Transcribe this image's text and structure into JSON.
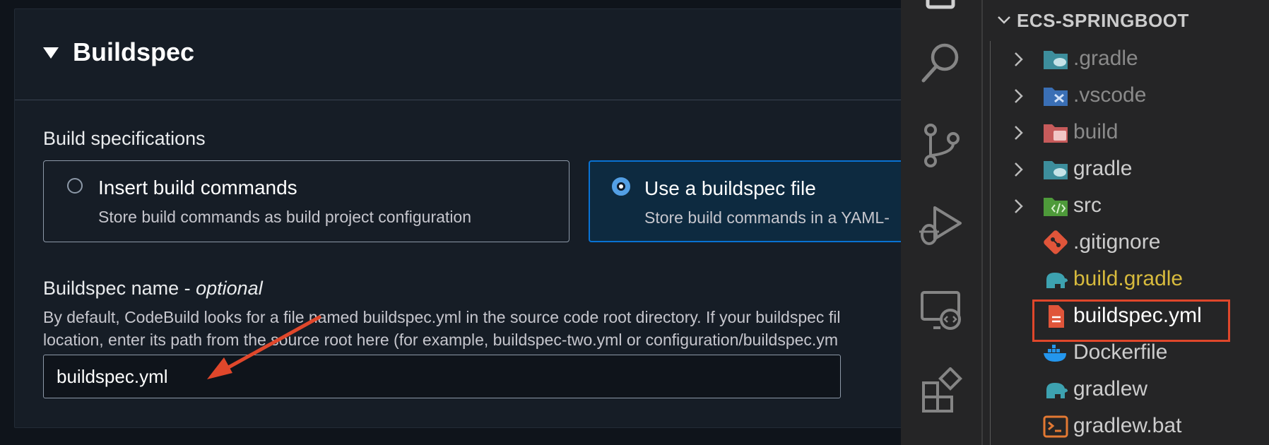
{
  "aws": {
    "section_title": "Buildspec",
    "build_spec_label": "Build specifications",
    "options": [
      {
        "title": "Insert build commands",
        "desc": "Store build commands as build project configuration",
        "selected": false
      },
      {
        "title": "Use a buildspec file",
        "desc": "Store build commands in a YAML-",
        "selected": true
      }
    ],
    "name_label": "Buildspec name - ",
    "name_label_optional": "optional",
    "help_line1": "By default, CodeBuild looks for a file named buildspec.yml in the source code root directory. If your buildspec fil",
    "help_line2": "location, enter its path from the source root here (for example, buildspec-two.yml or configuration/buildspec.ym",
    "input_value": "buildspec.yml",
    "arrow_color": "#e0472b"
  },
  "vscode": {
    "project_name": "ECS-SPRINGBOOT",
    "activity_icons": [
      "files-icon",
      "search-icon",
      "source-control-icon",
      "run-debug-icon",
      "remote-explorer-icon",
      "extensions-icon"
    ],
    "files": [
      {
        "name": ".gradle",
        "type": "folder",
        "icon": "gradle-folder-icon",
        "dim": true
      },
      {
        "name": ".vscode",
        "type": "folder",
        "icon": "vscode-folder-icon",
        "dim": true
      },
      {
        "name": "build",
        "type": "folder",
        "icon": "build-folder-icon",
        "dim": true
      },
      {
        "name": "gradle",
        "type": "folder",
        "icon": "gradle-folder-icon",
        "dim": false
      },
      {
        "name": "src",
        "type": "folder",
        "icon": "src-folder-icon",
        "dim": false
      },
      {
        "name": ".gitignore",
        "type": "file",
        "icon": "git-icon",
        "dim": false
      },
      {
        "name": "build.gradle",
        "type": "file",
        "icon": "gradle-elephant-icon",
        "dim": false,
        "modified": true
      },
      {
        "name": "buildspec.yml",
        "type": "file",
        "icon": "yaml-file-icon",
        "dim": false,
        "highlighted": true
      },
      {
        "name": "Dockerfile",
        "type": "file",
        "icon": "docker-icon",
        "dim": false
      },
      {
        "name": "gradlew",
        "type": "file",
        "icon": "gradle-elephant-icon",
        "dim": false
      },
      {
        "name": "gradlew.bat",
        "type": "file",
        "icon": "terminal-icon",
        "dim": false
      }
    ],
    "highlight_color": "#e0472b"
  }
}
